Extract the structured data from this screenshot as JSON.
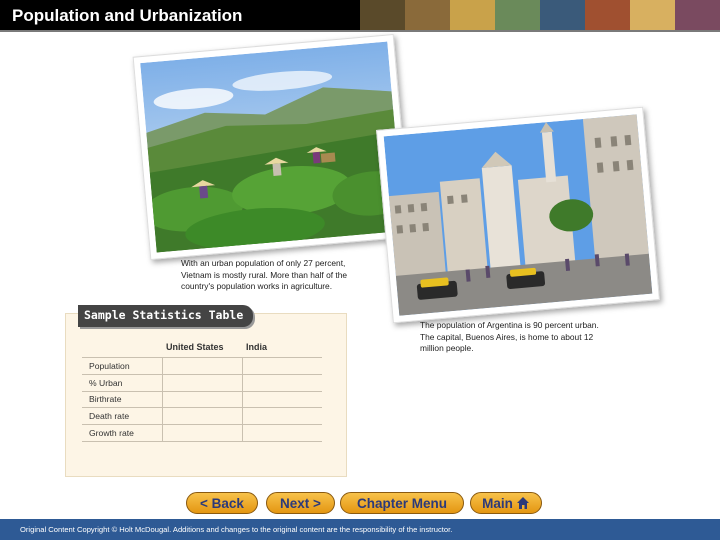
{
  "header": {
    "title": "Population and Urbanization",
    "banner_colors": [
      "#5a4a2a",
      "#8a6a3a",
      "#c9a24a",
      "#6a8a5a",
      "#3a5a7a",
      "#a05030",
      "#d8b060",
      "#7a4a60"
    ]
  },
  "photos": {
    "vietnam_caption": "With an urban population of only 27 percent, Vietnam is mostly rural. More than half of the country's population works in agriculture.",
    "argentina_caption": "The population of Argentina is 90 percent urban. The capital, Buenos Aires, is home to about 12 million people."
  },
  "stats_table": {
    "label": "Sample Statistics Table",
    "columns": [
      "",
      "United States",
      "India"
    ],
    "rows": [
      {
        "label": "Population"
      },
      {
        "label": "% Urban"
      },
      {
        "label": "Birthrate"
      },
      {
        "label": "Death rate"
      },
      {
        "label": "Growth rate"
      }
    ]
  },
  "nav": {
    "back": "< Back",
    "next": "Next >",
    "chapter_menu": "Chapter Menu",
    "main": "Main"
  },
  "footer": {
    "text": "Original Content Copyright © Holt McDougal. Additions and changes to the original content are the responsibility of the instructor."
  }
}
